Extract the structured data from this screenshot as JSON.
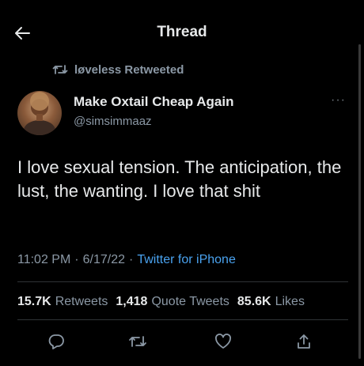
{
  "header": {
    "title": "Thread",
    "back_icon": "back-arrow-icon"
  },
  "retweet": {
    "icon": "retweet-icon",
    "text": "løveless Retweeted"
  },
  "author": {
    "name": "Make Oxtail Cheap Again",
    "handle": "@simsimmaaz",
    "more": "···"
  },
  "tweet": {
    "text": "I love sexual tension. The anticipation, the lust, the wanting. I love that shit"
  },
  "meta": {
    "time": "11:02 PM",
    "date": "6/17/22",
    "source": "Twitter for iPhone",
    "separator": "·"
  },
  "stats": {
    "retweets_count": "15.7K",
    "retweets_label": "Retweets",
    "quotes_count": "1,418",
    "quotes_label": "Quote Tweets",
    "likes_count": "85.6K",
    "likes_label": "Likes"
  },
  "actions": [
    "reply-icon",
    "retweet-icon",
    "like-icon",
    "share-icon"
  ],
  "colors": {
    "background": "#000000",
    "text": "#e7e9ea",
    "secondary": "#8b98a5",
    "link": "#4aa3f0",
    "divider": "#2f3336"
  }
}
